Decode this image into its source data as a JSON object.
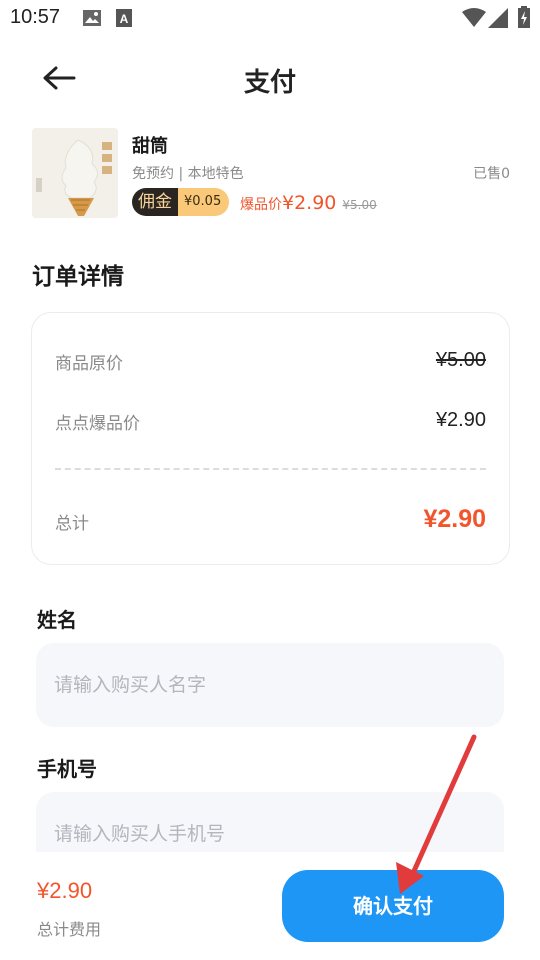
{
  "status_bar": {
    "time": "10:57"
  },
  "header": {
    "title": "支付",
    "back_icon": "arrow-left-icon"
  },
  "product": {
    "name": "甜筒",
    "tags": "免预约 | 本地特色",
    "sold": "已售0",
    "commission_label": "佣金",
    "commission_value": "¥0.05",
    "price_label": "爆品价",
    "price": "¥2.90",
    "original_price": "¥5.00"
  },
  "order_details": {
    "title": "订单详情",
    "rows": [
      {
        "label": "商品原价",
        "value": "¥5.00"
      },
      {
        "label": "点点爆品价",
        "value": "¥2.90"
      }
    ],
    "total_label": "总计",
    "total_value": "¥2.90"
  },
  "form": {
    "name_label": "姓名",
    "name_placeholder": "请输入购买人名字",
    "phone_label": "手机号",
    "phone_placeholder": "请输入购买人手机号"
  },
  "footer": {
    "total_price": "¥2.90",
    "total_caption": "总计费用",
    "pay_button_label": "确认支付"
  },
  "colors": {
    "accent_blue": "#1e96f6",
    "price_red": "#f2552c",
    "annotation_arrow": "#e23b3b"
  }
}
